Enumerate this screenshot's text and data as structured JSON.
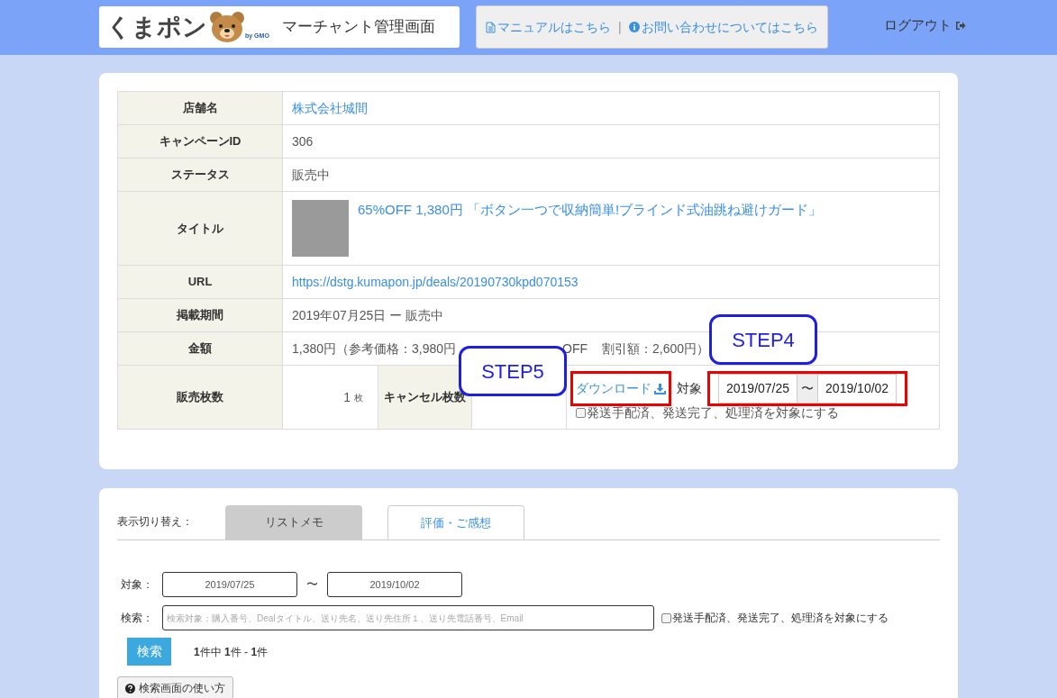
{
  "header": {
    "logo_text": "くまポン",
    "logo_sub": "by GMO",
    "title": "マーチャント管理画面",
    "links": [
      {
        "label": "マニュアルはこちら"
      },
      {
        "label": "お問い合わせについてはこちら"
      }
    ],
    "separator": "|",
    "logout": "ログアウト"
  },
  "info_table": [
    {
      "label": "店舗名",
      "kind": "link",
      "value": "株式会社城間"
    },
    {
      "label": "キャンペーンID",
      "kind": "text",
      "value": "306"
    },
    {
      "label": "ステータス",
      "kind": "text",
      "value": "販売中"
    },
    {
      "label": "タイトル",
      "kind": "title",
      "value": "65%OFF 1,380円 「ボタン一つで収納簡単!ブラインド式油跳ね避けガード」"
    },
    {
      "label": "URL",
      "kind": "link",
      "value": "https://dstg.kumapon.jp/deals/20190730kpd070153"
    },
    {
      "label": "掲載期間",
      "kind": "text",
      "value": "2019年07月25日 ー 販売中"
    },
    {
      "label": "金額",
      "kind": "amount",
      "parts": [
        "1,380円（参考価格：3,980円",
        "OFF",
        "割引額：2,600円）"
      ]
    }
  ],
  "sales": {
    "label": "販売枚数",
    "count": "1",
    "unit": "枚",
    "cancel_label": "キャンセル枚数",
    "download": "ダウンロード",
    "target_label": "対象",
    "from": "2019/07/25",
    "tilde": "〜",
    "to": "2019/10/02",
    "checkbox": {
      "label": "発送手配済、発送完了、処理済を対象にする",
      "checked": false
    }
  },
  "callouts": [
    {
      "label": "STEP4"
    },
    {
      "label": "STEP5"
    }
  ],
  "view_switch": {
    "label": "表示切り替え：",
    "tabs": [
      {
        "label": "リストメモ",
        "selected": true
      },
      {
        "label": "評価・ご感想",
        "selected": false
      }
    ]
  },
  "search": {
    "target_label": "対象：",
    "from": "2019/07/25",
    "tilde": "〜",
    "to": "2019/10/02",
    "search_label": "検索：",
    "placeholder": "検索対象：購入番号、Dealタイトル、送り先名、送り先住所１、送り先電話番号、Email",
    "checkbox": {
      "label": "発送手配済、発送完了、処理済を対象にする",
      "checked": false
    },
    "button": "検索",
    "result": "**1**件中 **1**件 - **1**件",
    "help": "検索画面の使い方"
  }
}
